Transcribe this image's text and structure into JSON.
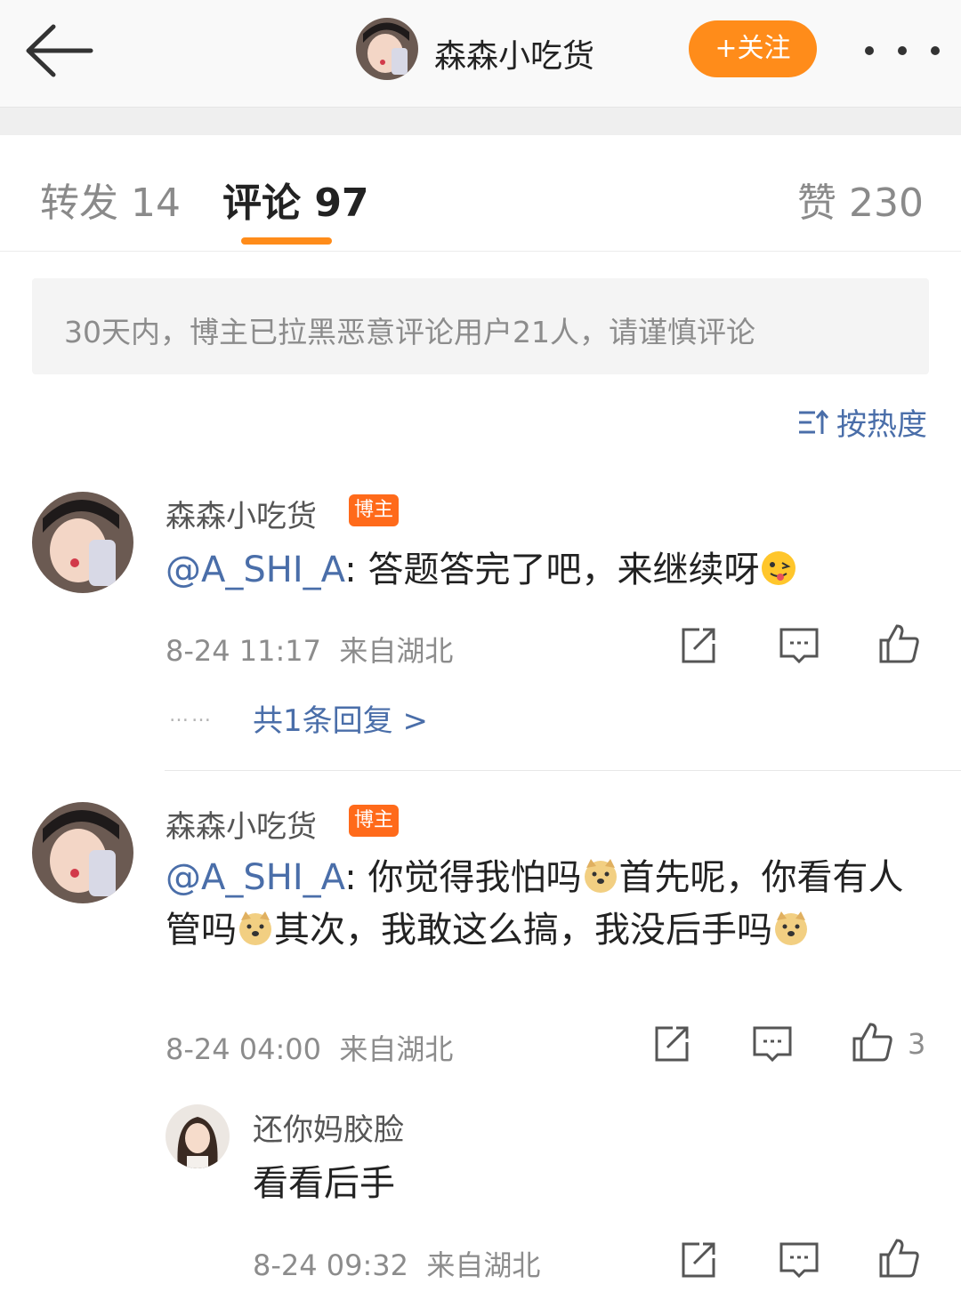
{
  "header": {
    "back_icon": "back-arrow-icon",
    "username": "森森小吃货",
    "follow_label": "+关注",
    "more_icon": "more-dots-icon"
  },
  "tabs": [
    {
      "label": "转发 14"
    },
    {
      "label": "评论 97"
    },
    {
      "label": "赞 230"
    }
  ],
  "notice": "30天内，博主已拉黑恶意评论用户21人，请谨慎评论",
  "sort": {
    "label": "按热度",
    "icon": "sort-icon"
  },
  "comments": [
    {
      "user": "森森小吃货",
      "badge": "博主",
      "mention": "@A_SHI_A",
      "text_parts": [
        ": 答题答完了吧，来继续呀"
      ],
      "time": "8-24 11:17",
      "location": "来自湖北",
      "replies_dots": "……",
      "replies_link": "共1条回复 >"
    },
    {
      "user": "森森小吃货",
      "badge": "博主",
      "mention": "@A_SHI_A",
      "text_parts": [
        ": 你觉得我怕吗",
        "首先呢，你看",
        "有人管吗",
        "其次，我敢这么搞，我没后手吗"
      ],
      "time": "8-24 04:00",
      "location": "来自湖北",
      "likes": "3"
    },
    {
      "user": "还你妈胶脸",
      "text": "看看后手",
      "time": "8-24 09:32",
      "location": "来自湖北"
    }
  ],
  "colors": {
    "accent": "#ff8c1a",
    "link": "#4a6ea9",
    "badge": "#ff6a1a"
  }
}
